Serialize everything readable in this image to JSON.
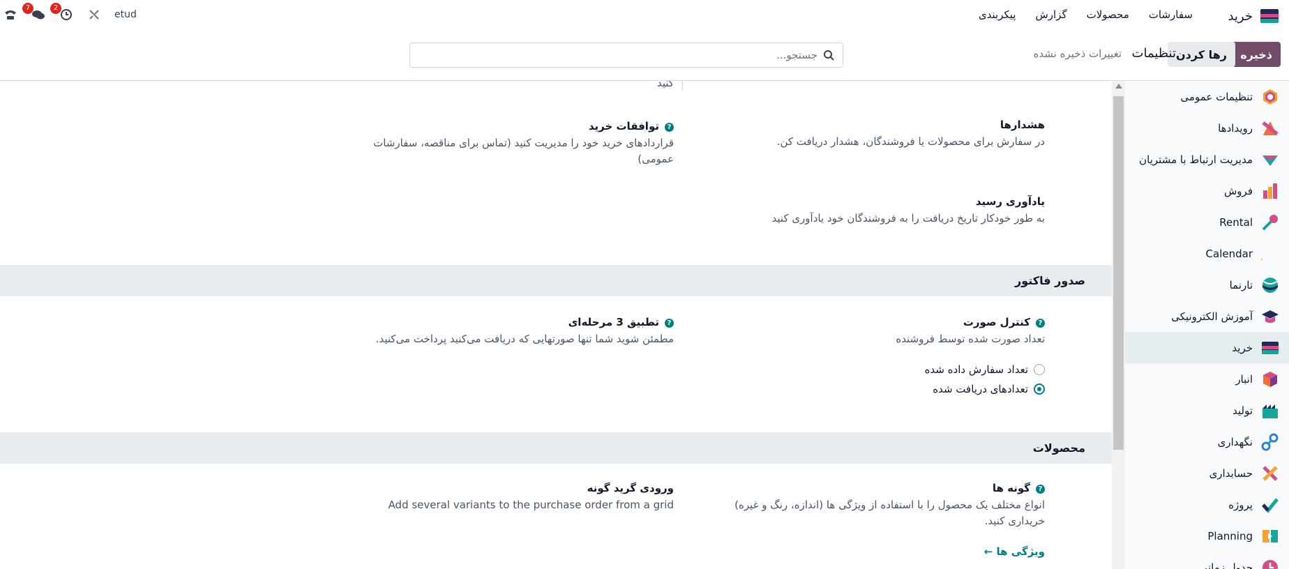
{
  "navbar": {
    "brand": "خرید",
    "menu": [
      "سفارشات",
      "محصولات",
      "گزارش",
      "پیکربندی"
    ],
    "db_name": "etud",
    "messages_count": "7",
    "activities_count": "2"
  },
  "control_panel": {
    "save_label": "ذخیره",
    "discard_label": "رها کردن",
    "title": "تنظیمات",
    "unsaved": "تغییرات ذخیره نشده",
    "search_placeholder": "جستجو..."
  },
  "sidebar": {
    "items": [
      {
        "label": "تنظیمات عمومی",
        "icon": "general-settings-icon"
      },
      {
        "label": "رویدادها",
        "icon": "events-icon"
      },
      {
        "label": "مدیریت ارتباط با مشتریان",
        "icon": "crm-icon"
      },
      {
        "label": "فروش",
        "icon": "sales-icon"
      },
      {
        "label": "Rental",
        "icon": "rental-icon"
      },
      {
        "label": "Calendar",
        "icon": "calendar-icon"
      },
      {
        "label": "تارنما",
        "icon": "website-icon"
      },
      {
        "label": "آموزش الکترونیکی",
        "icon": "elearning-icon"
      },
      {
        "label": "خرید",
        "icon": "purchase-icon"
      },
      {
        "label": "انبار",
        "icon": "inventory-icon"
      },
      {
        "label": "تولید",
        "icon": "manufacturing-icon"
      },
      {
        "label": "نگهداری",
        "icon": "maintenance-icon"
      },
      {
        "label": "حسابداری",
        "icon": "accounting-icon"
      },
      {
        "label": "پروژه",
        "icon": "project-icon"
      },
      {
        "label": "Planning",
        "icon": "planning-icon"
      },
      {
        "label": "جدول زمانی",
        "icon": "timesheet-icon"
      }
    ],
    "active_index": 8
  },
  "content": {
    "top_fragment": "کنید",
    "orders": {
      "warnings": {
        "title": "هشدارها",
        "desc": "در سفارش برای محصولات یا فروشندگان، هشدار دریافت کن.",
        "checked": false
      },
      "agreements": {
        "title": "توافقات خرید",
        "desc": "قراردادهای خرید خود را مدیریت کنید (تماس برای مناقصه، سفارشات عمومی)",
        "checked": false
      },
      "receipt_reminder": {
        "title": "یادآوری رسید",
        "desc": "به طور خودکار تاریخ دریافت را به فروشندگان خود یادآوری کنید",
        "checked": true
      }
    },
    "invoicing": {
      "heading": "صدور فاکتور",
      "bill_control": {
        "title": "کنترل صورت",
        "desc": "تعداد صورت شده توسط فروشنده",
        "options": [
          "تعداد سفارش داده شده",
          "تعدادهای دریافت شده"
        ],
        "selected": 1
      },
      "three_way": {
        "title": "تطبیق 3 مرحله‌ای",
        "desc": "مطمئن شوید شما تنها صورتهایی که دریافت می‌کنید پرداخت می‌کنید.",
        "checked": true
      }
    },
    "products": {
      "heading": "محصولات",
      "variants": {
        "title": "گونه ها",
        "desc": "انواع مختلف یک محصول را با استفاده از ویژگی ها (اندازه، رنگ و غیره) خریداری کنید.",
        "checked": true,
        "link": "ویژگی ها"
      },
      "grid_entry": {
        "title": "ورودی گرید گونه",
        "desc": "Add several variants to the purchase order from a grid",
        "checked": false
      }
    }
  }
}
